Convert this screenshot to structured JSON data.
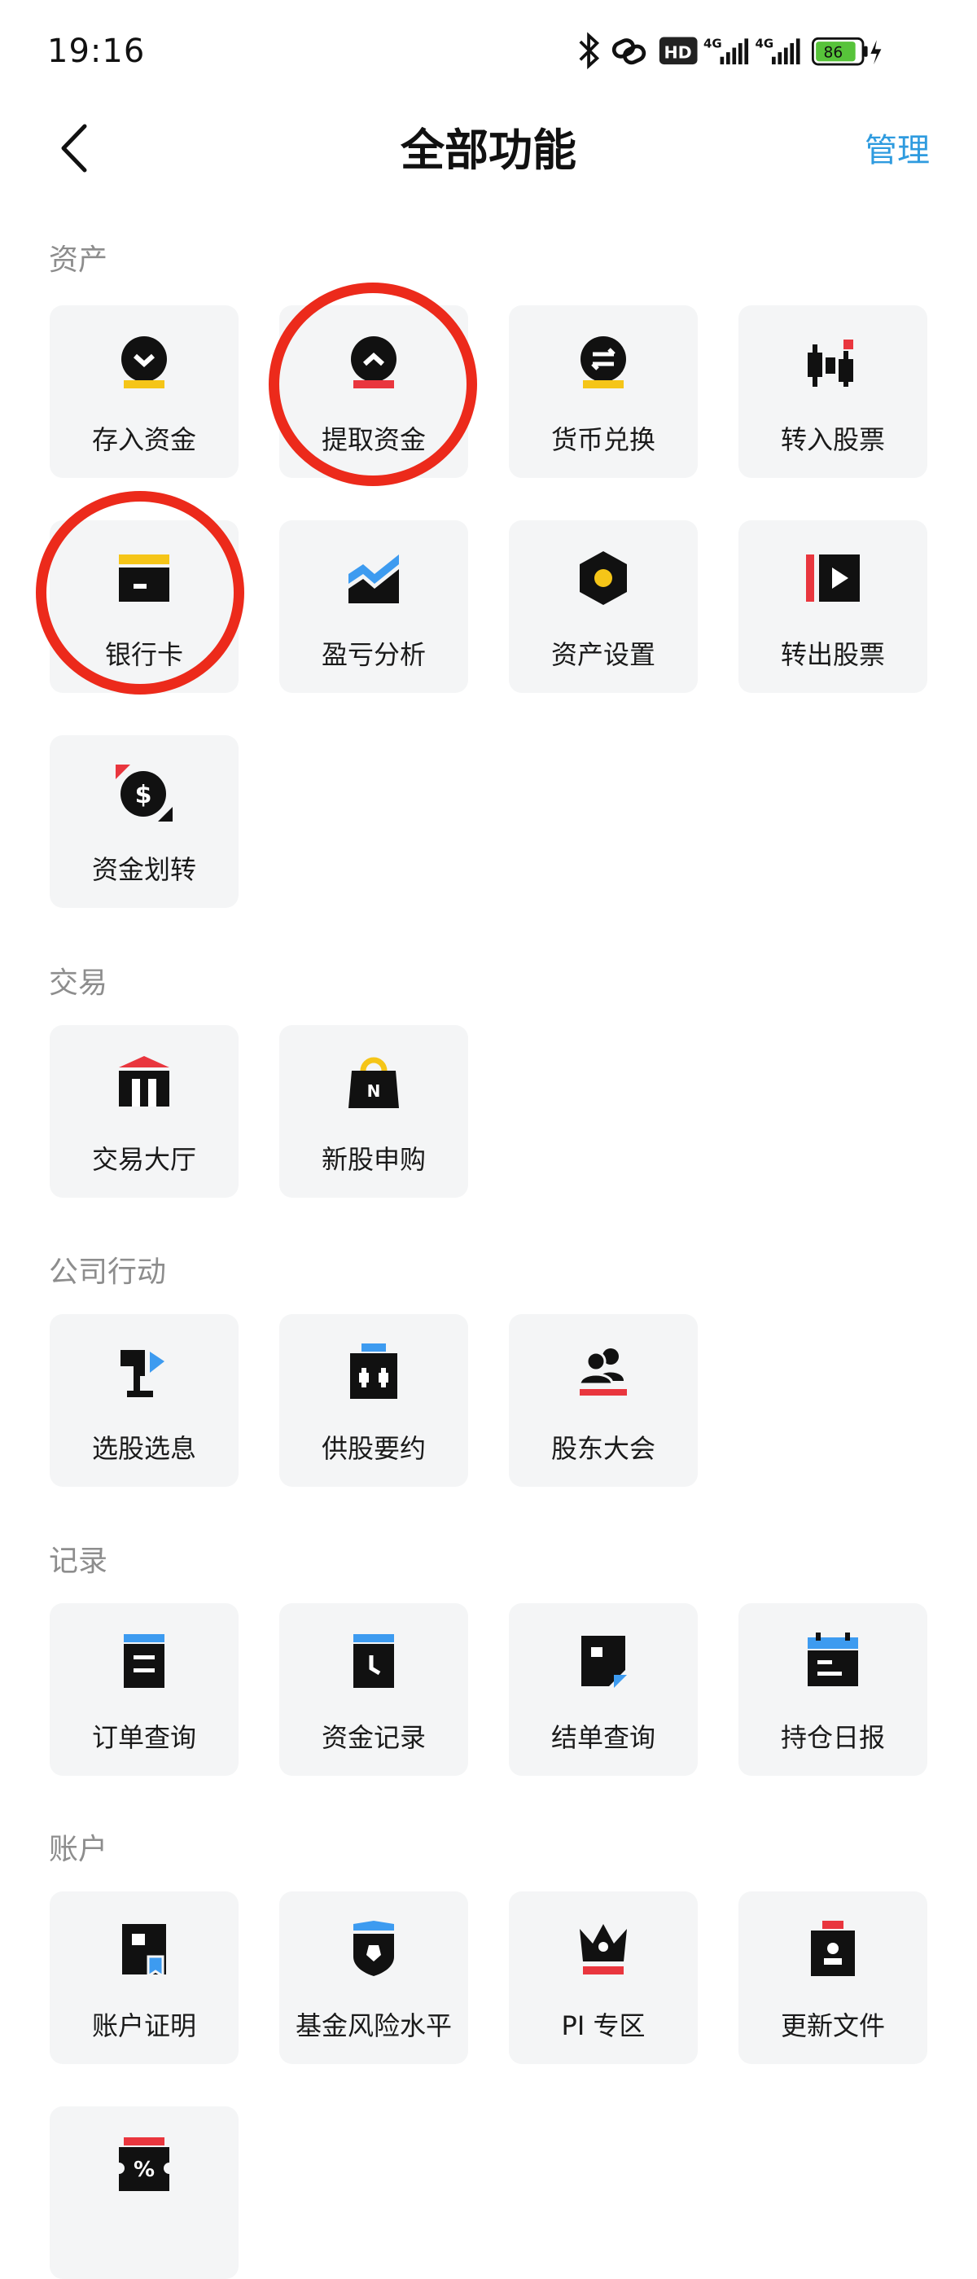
{
  "status_bar": {
    "time": "19:16",
    "battery": "86",
    "hd_label": "HD",
    "net1": "4G",
    "net2": "4G"
  },
  "header": {
    "title": "全部功能",
    "manage_label": "管理",
    "back_icon": "chevron-left-icon"
  },
  "sections": {
    "assets": {
      "title": "资产",
      "items": [
        {
          "label": "存入资金",
          "icon": "deposit-icon"
        },
        {
          "label": "提取资金",
          "icon": "withdraw-icon"
        },
        {
          "label": "货币兑换",
          "icon": "currency-exchange-icon"
        },
        {
          "label": "转入股票",
          "icon": "transfer-in-stock-icon"
        },
        {
          "label": "银行卡",
          "icon": "bank-card-icon"
        },
        {
          "label": "盈亏分析",
          "icon": "profit-analysis-icon"
        },
        {
          "label": "资产设置",
          "icon": "asset-settings-icon"
        },
        {
          "label": "转出股票",
          "icon": "transfer-out-stock-icon"
        },
        {
          "label": "资金划转",
          "icon": "fund-transfer-icon"
        }
      ]
    },
    "trade": {
      "title": "交易",
      "items": [
        {
          "label": "交易大厅",
          "icon": "trading-hall-icon"
        },
        {
          "label": "新股申购",
          "icon": "ipo-subscribe-icon"
        }
      ]
    },
    "corporate": {
      "title": "公司行动",
      "items": [
        {
          "label": "选股选息",
          "icon": "stock-dividend-choice-icon"
        },
        {
          "label": "供股要约",
          "icon": "rights-offer-icon"
        },
        {
          "label": "股东大会",
          "icon": "shareholder-meeting-icon"
        }
      ]
    },
    "records": {
      "title": "记录",
      "items": [
        {
          "label": "订单查询",
          "icon": "order-query-icon"
        },
        {
          "label": "资金记录",
          "icon": "fund-record-icon"
        },
        {
          "label": "结单查询",
          "icon": "statement-query-icon"
        },
        {
          "label": "持仓日报",
          "icon": "position-daily-icon"
        }
      ]
    },
    "account": {
      "title": "账户",
      "items": [
        {
          "label": "账户证明",
          "icon": "account-proof-icon"
        },
        {
          "label": "基金风险水平",
          "icon": "fund-risk-icon"
        },
        {
          "label": "PI 专区",
          "icon": "pi-zone-icon"
        },
        {
          "label": "更新文件",
          "icon": "update-documents-icon"
        },
        {
          "label": "",
          "icon": "discount-coupon-icon"
        }
      ]
    }
  },
  "colors": {
    "accent_blue": "#2e9bdf",
    "highlight_red": "#ec2a1b",
    "icon_yellow": "#f5c518",
    "icon_red": "#e9363e",
    "icon_blue": "#3d9bf0",
    "tile_bg": "#f4f5f6"
  }
}
